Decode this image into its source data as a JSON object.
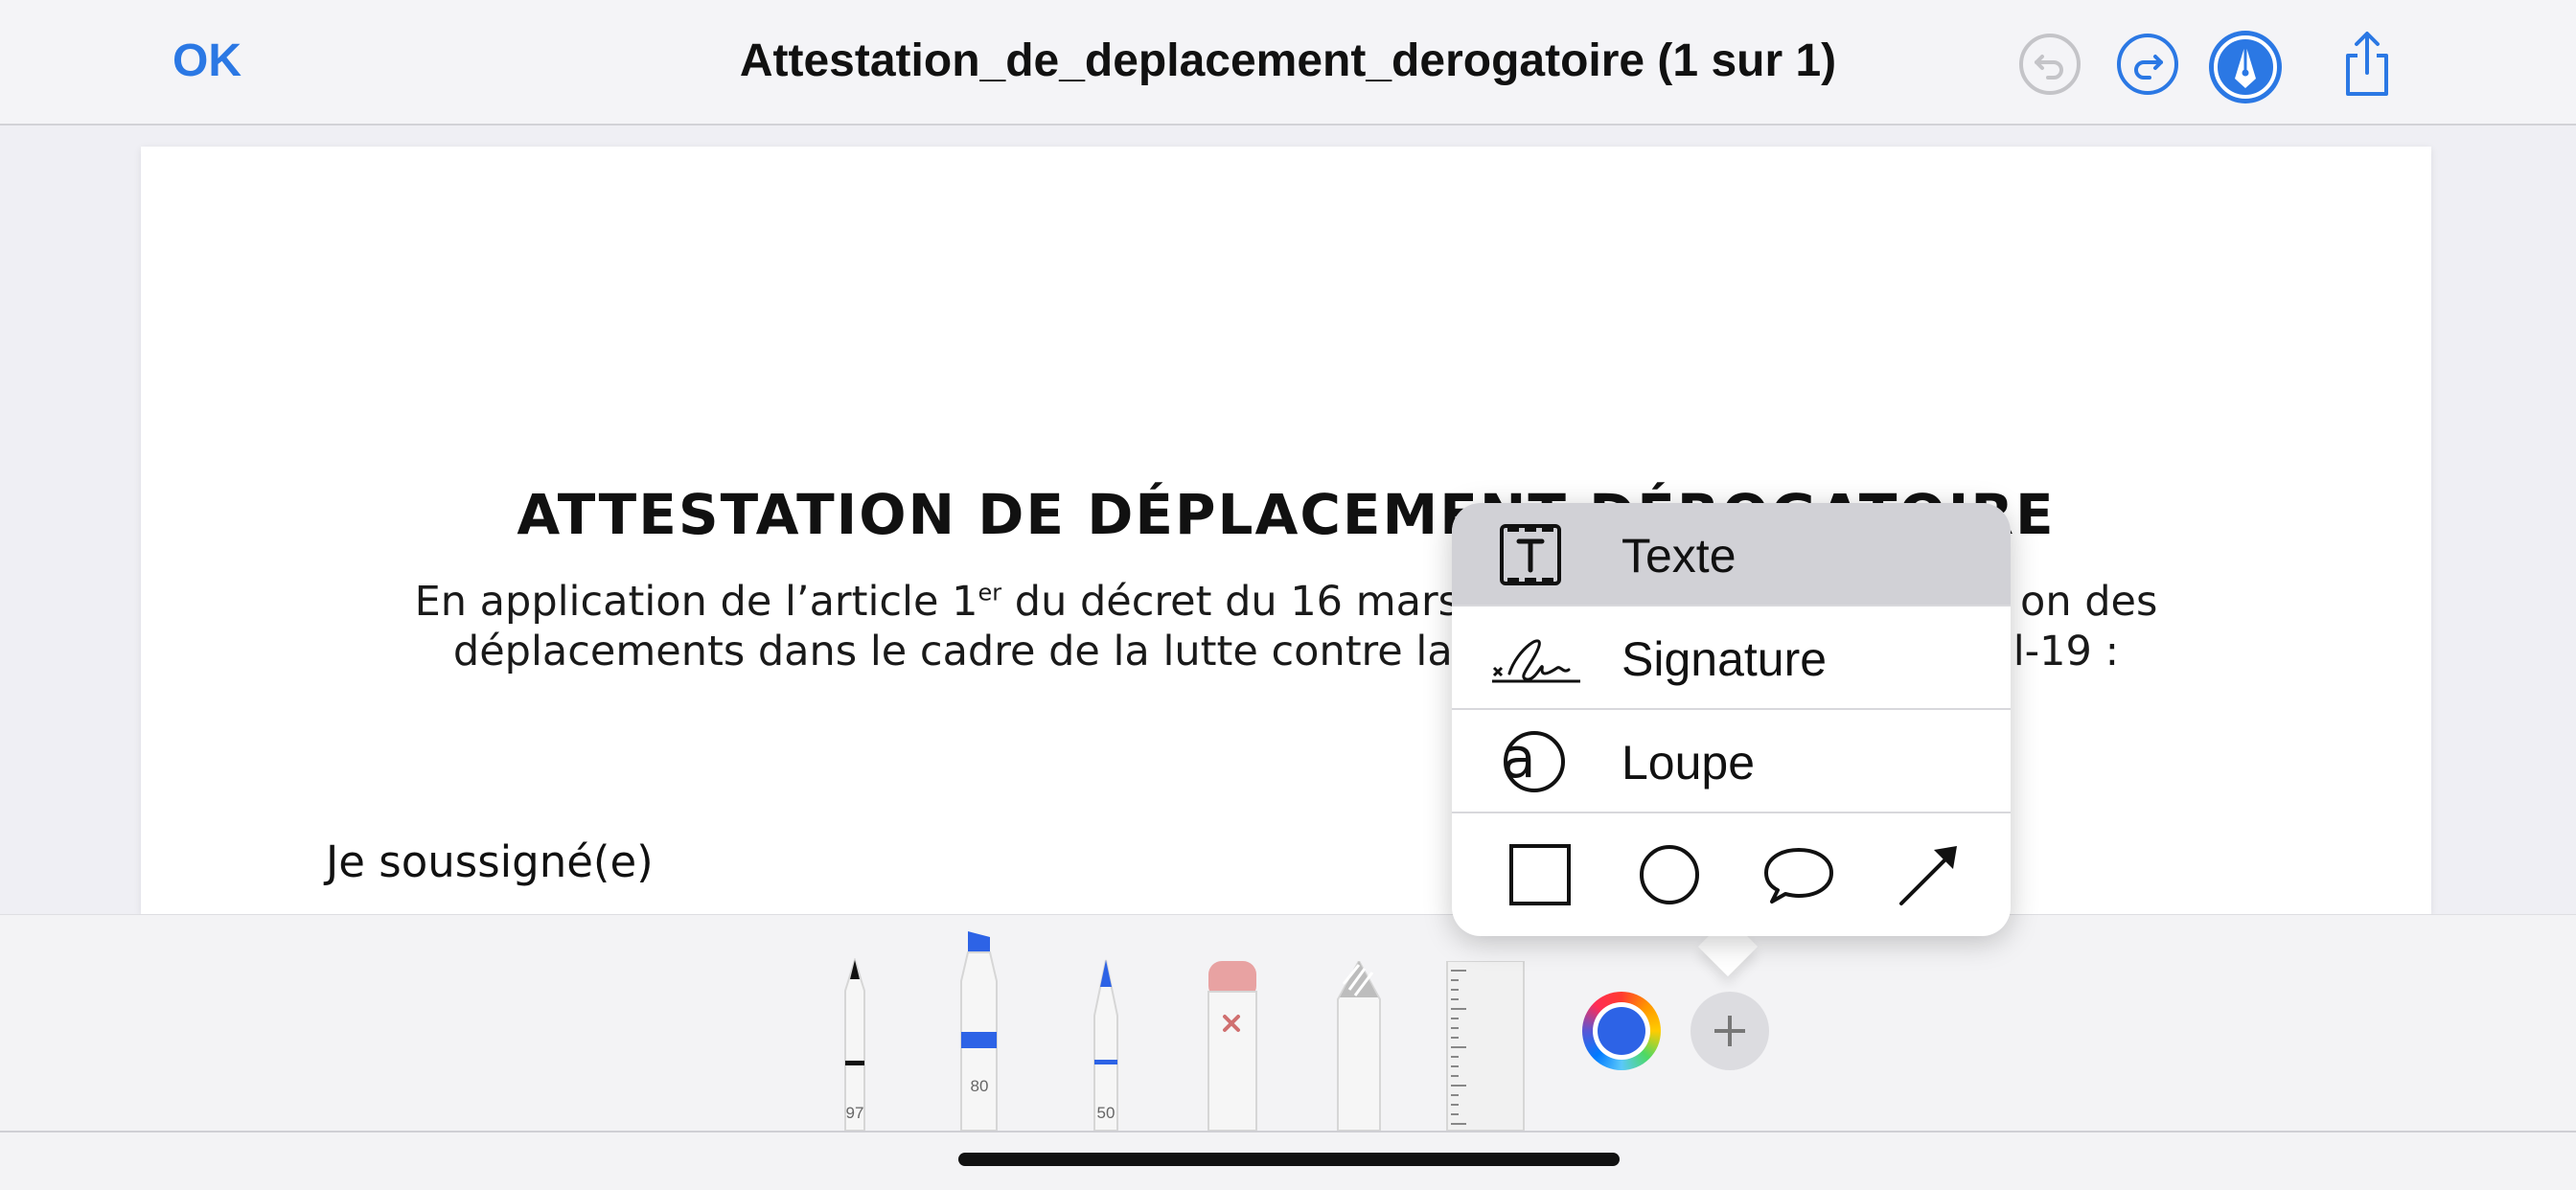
{
  "nav": {
    "ok_label": "OK",
    "title": "Attestation_de_deplacement_derogatoire (1 sur 1)"
  },
  "document": {
    "title": "ATTESTATION DE DÉPLACEMENT DÉROGATOIRE",
    "para_line1_a": "En application de l’article 1",
    "para_line1_sup": "er",
    "para_line1_b": " du décret du 16 mars",
    "para_line1_c": "on des",
    "para_line2_a": "déplacements dans le cadre de la lutte contre la",
    "para_line2_c": "l-19 :",
    "soussigne": "Je soussigné(e)"
  },
  "tools": {
    "pen_width": "97",
    "highlighter_width": "80",
    "pencil_width": "50",
    "current_color": "#2d63e6",
    "accent_color": "#2b78e4"
  },
  "popover": {
    "items": [
      {
        "label": "Texte",
        "icon": "text-box-icon"
      },
      {
        "label": "Signature",
        "icon": "signature-icon"
      },
      {
        "label": "Loupe",
        "icon": "magnifier-icon"
      }
    ],
    "shapes": [
      "square-icon",
      "circle-icon",
      "speech-bubble-icon",
      "arrow-icon"
    ]
  }
}
